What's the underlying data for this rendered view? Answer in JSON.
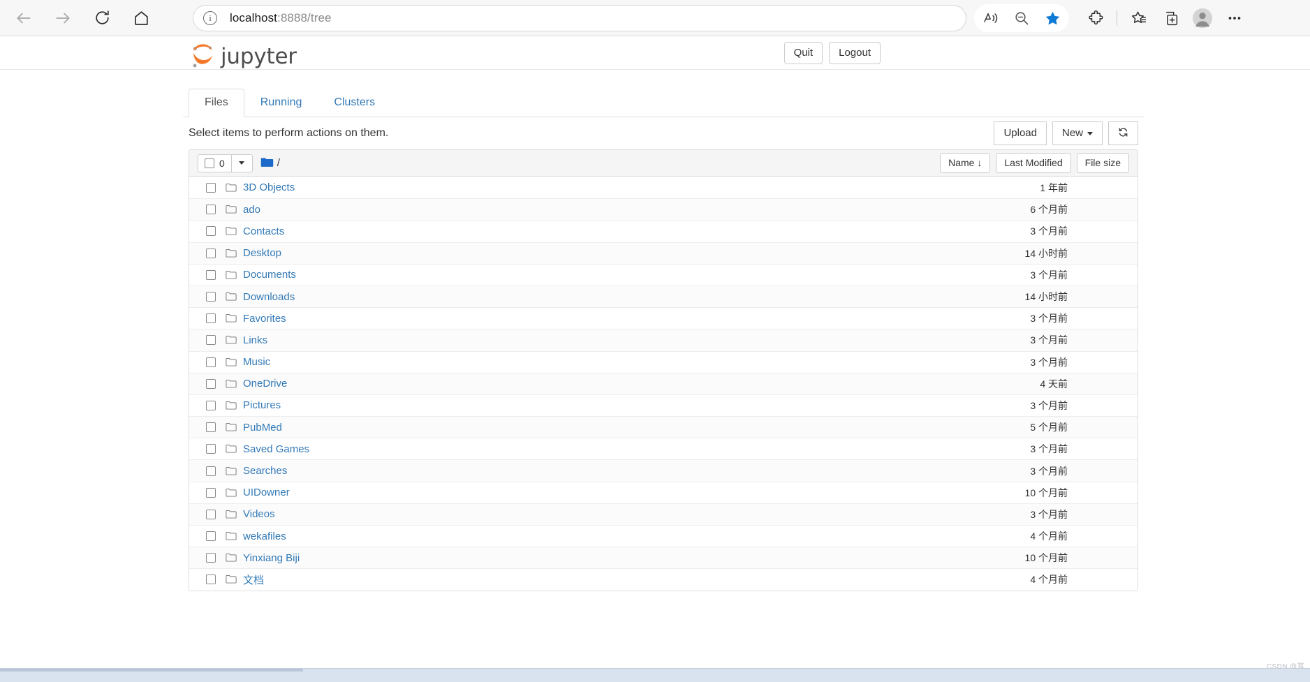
{
  "browser": {
    "url_host": "localhost",
    "url_path": ":8888/tree",
    "back_icon": "back-arrow-icon",
    "forward_icon": "forward-arrow-icon",
    "reload_icon": "reload-icon",
    "home_icon": "home-icon",
    "info_icon": "info-icon",
    "read_aloud_icon": "read-aloud-icon",
    "zoom_out_icon": "zoom-out-icon",
    "favorite_icon": "favorite-star-filled-icon",
    "extensions_icon": "extensions-puzzle-icon",
    "favorites_icon": "favorites-star-list-icon",
    "collections_icon": "collections-icon",
    "profile_icon": "profile-avatar-icon",
    "settings_icon": "settings-ellipsis-icon",
    "favorite_color": "#0f7bd4"
  },
  "jupyter": {
    "brand": "jupyter",
    "logo_color": "#f37726",
    "link_color": "#337ab7",
    "header_buttons": [
      {
        "label": "Quit",
        "name": "quit-button"
      },
      {
        "label": "Logout",
        "name": "logout-button"
      }
    ],
    "tabs": [
      {
        "label": "Files",
        "active": true
      },
      {
        "label": "Running",
        "active": false
      },
      {
        "label": "Clusters",
        "active": false
      }
    ],
    "select_hint": "Select items to perform actions on them.",
    "actions": {
      "upload": "Upload",
      "new": "New",
      "refresh_icon": "refresh-icon"
    },
    "list_toolbar": {
      "selected_count": "0",
      "breadcrumb_root": "/",
      "folder_icon": "folder-filled-icon",
      "sort_name": "Name",
      "sort_name_arrow": "↓",
      "sort_last_modified": "Last Modified",
      "sort_file_size": "File size"
    },
    "files": [
      {
        "name": "3D Objects",
        "modified": "1 年前"
      },
      {
        "name": "ado",
        "modified": "6 个月前"
      },
      {
        "name": "Contacts",
        "modified": "3 个月前"
      },
      {
        "name": "Desktop",
        "modified": "14 小时前"
      },
      {
        "name": "Documents",
        "modified": "3 个月前"
      },
      {
        "name": "Downloads",
        "modified": "14 小时前"
      },
      {
        "name": "Favorites",
        "modified": "3 个月前"
      },
      {
        "name": "Links",
        "modified": "3 个月前"
      },
      {
        "name": "Music",
        "modified": "3 个月前"
      },
      {
        "name": "OneDrive",
        "modified": "4 天前"
      },
      {
        "name": "Pictures",
        "modified": "3 个月前"
      },
      {
        "name": "PubMed",
        "modified": "5 个月前"
      },
      {
        "name": "Saved Games",
        "modified": "3 个月前"
      },
      {
        "name": "Searches",
        "modified": "3 个月前"
      },
      {
        "name": "UIDowner",
        "modified": "10 个月前"
      },
      {
        "name": "Videos",
        "modified": "3 个月前"
      },
      {
        "name": "wekafiles",
        "modified": "4 个月前"
      },
      {
        "name": "Yinxiang Biji",
        "modified": "10 个月前"
      },
      {
        "name": "文档",
        "modified": "4 个月前"
      }
    ]
  },
  "watermark": "CSDN @耳"
}
